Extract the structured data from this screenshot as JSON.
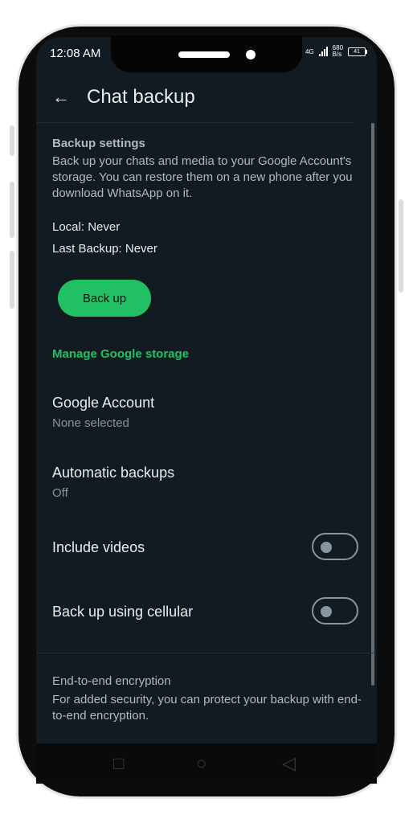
{
  "status_bar": {
    "time": "12:08 AM",
    "network": "4G",
    "speed_value": "680",
    "speed_unit": "B/s",
    "battery": "41"
  },
  "app_bar": {
    "title": "Chat backup",
    "back_icon": "back-arrow-icon"
  },
  "backup_settings": {
    "title": "Backup settings",
    "description": "Back up your chats and media to your Google Account's storage. You can restore them on a new phone after you download WhatsApp on it.",
    "local": "Local: Never",
    "last_backup": "Last Backup: Never",
    "button_label": "Back up",
    "manage_link": "Manage Google storage"
  },
  "items": {
    "google_account": {
      "title": "Google Account",
      "subtitle": "None selected"
    },
    "automatic_backups": {
      "title": "Automatic backups",
      "subtitle": "Off"
    },
    "include_videos": {
      "title": "Include videos",
      "enabled": false
    },
    "cellular": {
      "title": "Back up using cellular",
      "enabled": false
    }
  },
  "encryption": {
    "title": "End-to-end encryption",
    "description": "For added security, you can protect your backup with end-to-end encryption."
  },
  "nav_bar": {
    "icons": [
      "recent-apps-icon",
      "home-icon",
      "back-icon"
    ]
  },
  "colors": {
    "accent": "#21c063",
    "background": "#121b22",
    "text": "#e9edef",
    "secondary_text": "#8696a0"
  }
}
